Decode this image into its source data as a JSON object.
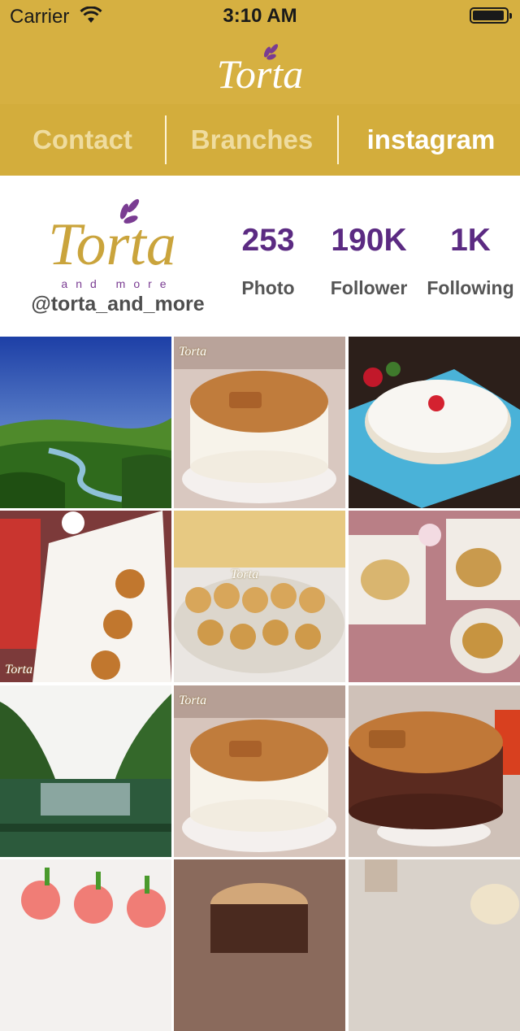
{
  "status_bar": {
    "carrier": "Carrier",
    "time": "3:10 AM"
  },
  "nav": {
    "brand_title": "Torta"
  },
  "tabs": [
    {
      "label": "Contact",
      "active": false
    },
    {
      "label": "Branches",
      "active": false
    },
    {
      "label": "instagram",
      "active": true
    }
  ],
  "profile": {
    "logo_text": "Torta",
    "logo_subtext": "and more",
    "handle": "@torta_and_more",
    "stats": [
      {
        "value": "253",
        "label": "Photo"
      },
      {
        "value": "190K",
        "label": "Follower"
      },
      {
        "value": "1K",
        "label": "Following"
      }
    ]
  },
  "grid": {
    "watermark": "Torta",
    "photos": [
      {
        "subject": "river valley landscape"
      },
      {
        "subject": "lotus biscuit cheesecake"
      },
      {
        "subject": "strawberry cream cake"
      },
      {
        "subject": "lotus mini cookies"
      },
      {
        "subject": "mini sandwich buns"
      },
      {
        "subject": "sugar crust buns"
      },
      {
        "subject": "river landscape"
      },
      {
        "subject": "lotus biscuit cheesecake"
      },
      {
        "subject": "lotus chocolate cake"
      },
      {
        "subject": "cupcakes"
      },
      {
        "subject": "cake slice"
      },
      {
        "subject": "pastries"
      }
    ]
  },
  "colors": {
    "header": "#d6b041",
    "tabs": "#d3ad3c",
    "tab_inactive": "#efdc9f",
    "stat_purple": "#5b2a82",
    "logo_gold": "#caa43c"
  }
}
